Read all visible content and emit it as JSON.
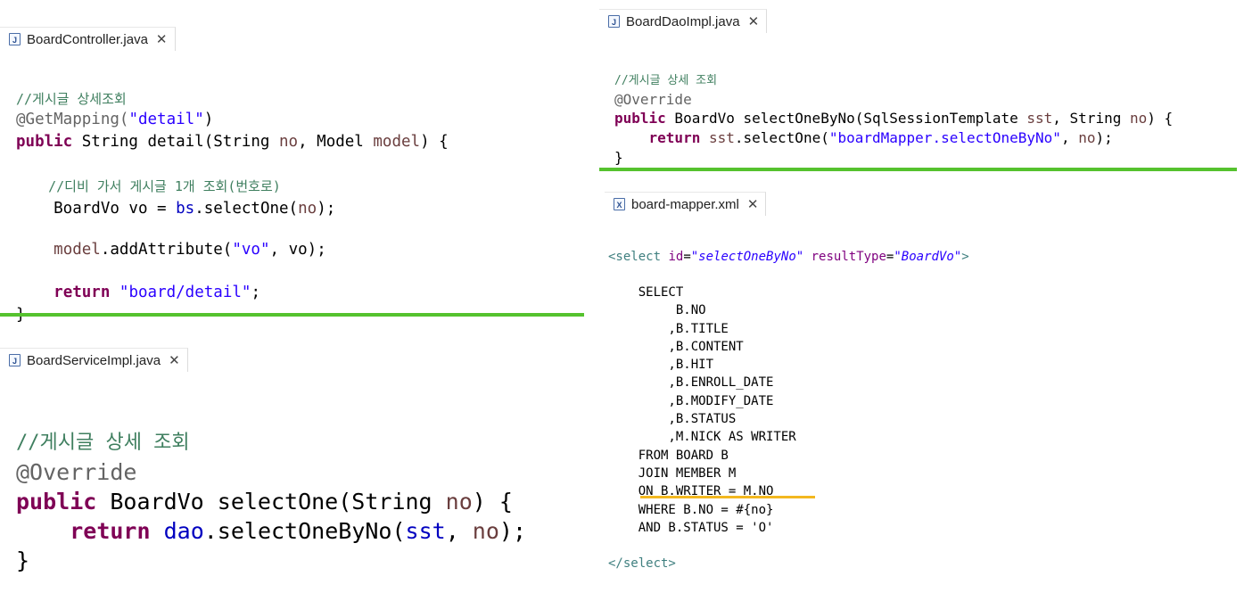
{
  "controller": {
    "tab_label": "BoardController.java",
    "tab_icon": "java-file-icon",
    "lines": [
      "//게시글 상세조회",
      "@GetMapping(\"detail\")",
      "public String detail(String no, Model model) {",
      "",
      "    //디비 가서 게시글 1개 조회(번호로)",
      "    BoardVo vo = bs.selectOne(no);",
      "",
      "    model.addAttribute(\"vo\", vo);",
      "",
      "    return \"board/detail\";",
      "}"
    ]
  },
  "service": {
    "tab_label": "BoardServiceImpl.java",
    "tab_icon": "java-file-icon",
    "lines": [
      "//게시글 상세 조회",
      "@Override",
      "public BoardVo selectOne(String no) {",
      "    return dao.selectOneByNo(sst, no);",
      "}"
    ]
  },
  "dao": {
    "tab_label": "BoardDaoImpl.java",
    "tab_icon": "java-file-icon",
    "lines": [
      "//게시글 상세 조회",
      "@Override",
      "public BoardVo selectOneByNo(SqlSessionTemplate sst, String no) {",
      "    return sst.selectOne(\"boardMapper.selectOneByNo\", no);",
      "}"
    ]
  },
  "mapper": {
    "tab_label": "board-mapper.xml",
    "tab_icon": "xml-file-icon",
    "lines": [
      "<select id=\"selectOneByNo\" resultType=\"BoardVo\">",
      "",
      "    SELECT",
      "         B.NO",
      "        ,B.TITLE",
      "        ,B.CONTENT",
      "        ,B.HIT",
      "        ,B.ENROLL_DATE",
      "        ,B.MODIFY_DATE",
      "        ,B.STATUS",
      "        ,M.NICK AS WRITER",
      "    FROM BOARD B",
      "    JOIN MEMBER M",
      "    ON B.WRITER = M.NO",
      "    WHERE B.NO = #{no}",
      "    AND B.STATUS = 'O'",
      "",
      "</select>"
    ],
    "highlighted_line": "    WHERE B.NO = #{no}",
    "highlight_color": "#f3b81f"
  },
  "colors": {
    "separator": "#55c22e",
    "comment": "#3f7f5f",
    "keyword": "#7f0055",
    "string": "#2a00ff",
    "field": "#0000c0",
    "annotation": "#646464"
  }
}
